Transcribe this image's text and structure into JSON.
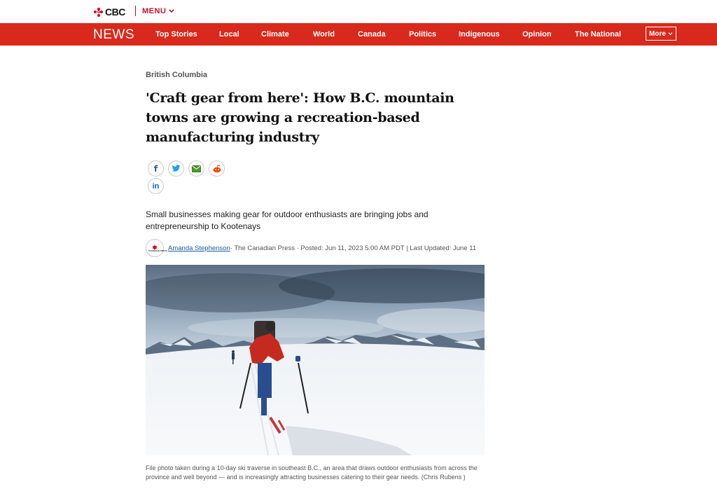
{
  "header": {
    "logo_text": "CBC",
    "menu_label": "MENU"
  },
  "nav": {
    "news_label": "NEWS",
    "items": [
      "Top Stories",
      "Local",
      "Climate",
      "World",
      "Canada",
      "Politics",
      "Indigenous",
      "Opinion",
      "The National"
    ],
    "more_label": "More"
  },
  "article": {
    "section": "British Columbia",
    "headline": "'Craft gear from here': How B.C. mountain towns are growing a recreation-based manufacturing industry",
    "deck": "Small businesses making gear for outdoor enthusiasts are bringing jobs and entrepreneurship to Kootenays",
    "share_icons": [
      "facebook-icon",
      "twitter-icon",
      "email-icon",
      "reddit-icon",
      "linkedin-icon"
    ],
    "byline": {
      "author": "Amanda Stephenson",
      "source": " · The Canadian Press · Posted: Jun 11, 2023 5:00 AM PDT | Last Updated: June 11",
      "avatar_text": "CANADIAN PRESS"
    },
    "caption": "File photo taken during a 10-day ski traverse in southeast B.C., an area that draws outdoor enthusiasts from across the province and well beyond — and is increasingly attracting businesses catering to their gear needs. (Chris Rubens )"
  },
  "colors": {
    "brand_red": "#d9291c",
    "link_blue": "#1a5fa0"
  }
}
